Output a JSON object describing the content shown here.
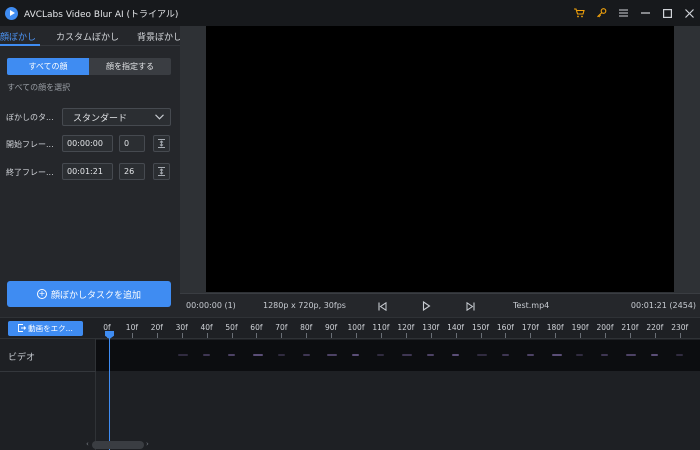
{
  "window": {
    "title": "AVCLabs Video Blur AI (トライアル)",
    "icons": [
      "cart-icon",
      "key-icon",
      "menu-icon",
      "minimize-icon",
      "maximize-icon",
      "close-icon"
    ]
  },
  "tabs": [
    {
      "label": "顔ぼかし",
      "active": true
    },
    {
      "label": "カスタムぼかし",
      "active": false
    },
    {
      "label": "背景ぼかし",
      "active": false
    }
  ],
  "face_mode": {
    "all_faces": "すべての顔",
    "specify_faces": "顔を指定する",
    "selected_hint": "すべての顔を選択"
  },
  "blur_type": {
    "label": "ぼかしのタ...",
    "value": "スタンダード"
  },
  "start_frame": {
    "label": "開始フレー...",
    "time": "00:00:00",
    "frame": "0"
  },
  "end_frame": {
    "label": "終了フレー...",
    "time": "00:01:21",
    "frame": "26"
  },
  "add_task_label": "顔ぼかしタスクを追加",
  "player": {
    "current": "00:00:00 (1)",
    "resolution": "1280p x 720p, 30fps",
    "file": "Test.mp4",
    "duration": "00:01:21 (2454)"
  },
  "timeline": {
    "export_label": "動画をエク...",
    "track_label": "ビデオ",
    "ticks": [
      "0f",
      "10f",
      "20f",
      "30f",
      "40f",
      "50f",
      "60f",
      "70f",
      "80f",
      "90f",
      "100f",
      "110f",
      "120f",
      "130f",
      "140f",
      "150f",
      "160f",
      "170f",
      "180f",
      "190f",
      "200f",
      "210f",
      "220f",
      "230f"
    ]
  },
  "colors": {
    "accent": "#3f8cf2",
    "title_icon": "#f2a20c"
  }
}
